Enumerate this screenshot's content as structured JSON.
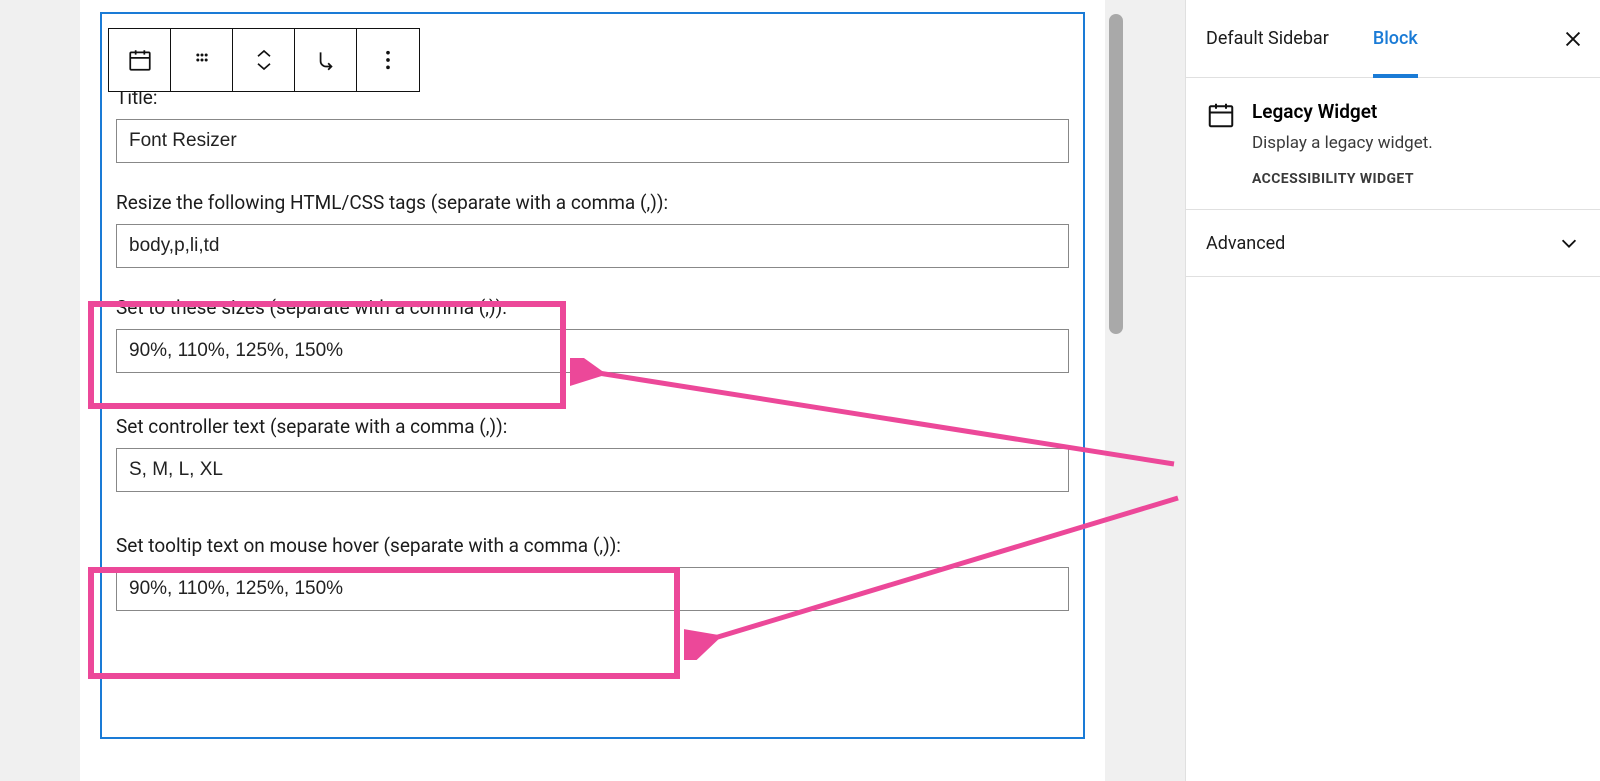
{
  "sidebar": {
    "tabs": {
      "default": "Default Sidebar",
      "block": "Block"
    },
    "blockInfo": {
      "title": "Legacy Widget",
      "description": "Display a legacy widget.",
      "sub": "ACCESSIBILITY WIDGET"
    },
    "advanced": "Advanced"
  },
  "form": {
    "titleLabel": "Title:",
    "titleValue": "Font Resizer",
    "tagsLabel": "Resize the following HTML/CSS tags (separate with a comma (,)):",
    "tagsValue": "body,p,li,td",
    "sizesLabel": "Set to these sizes (separate with a comma (,)):",
    "sizesValue": "90%, 110%, 125%, 150%",
    "controllerLabel": "Set controller text (separate with a comma (,)):",
    "controllerValue": "S, M, L, XL",
    "tooltipLabel": "Set tooltip text on mouse hover (separate with a comma (,)):",
    "tooltipValue": "90%, 110%, 125%, 150%"
  }
}
